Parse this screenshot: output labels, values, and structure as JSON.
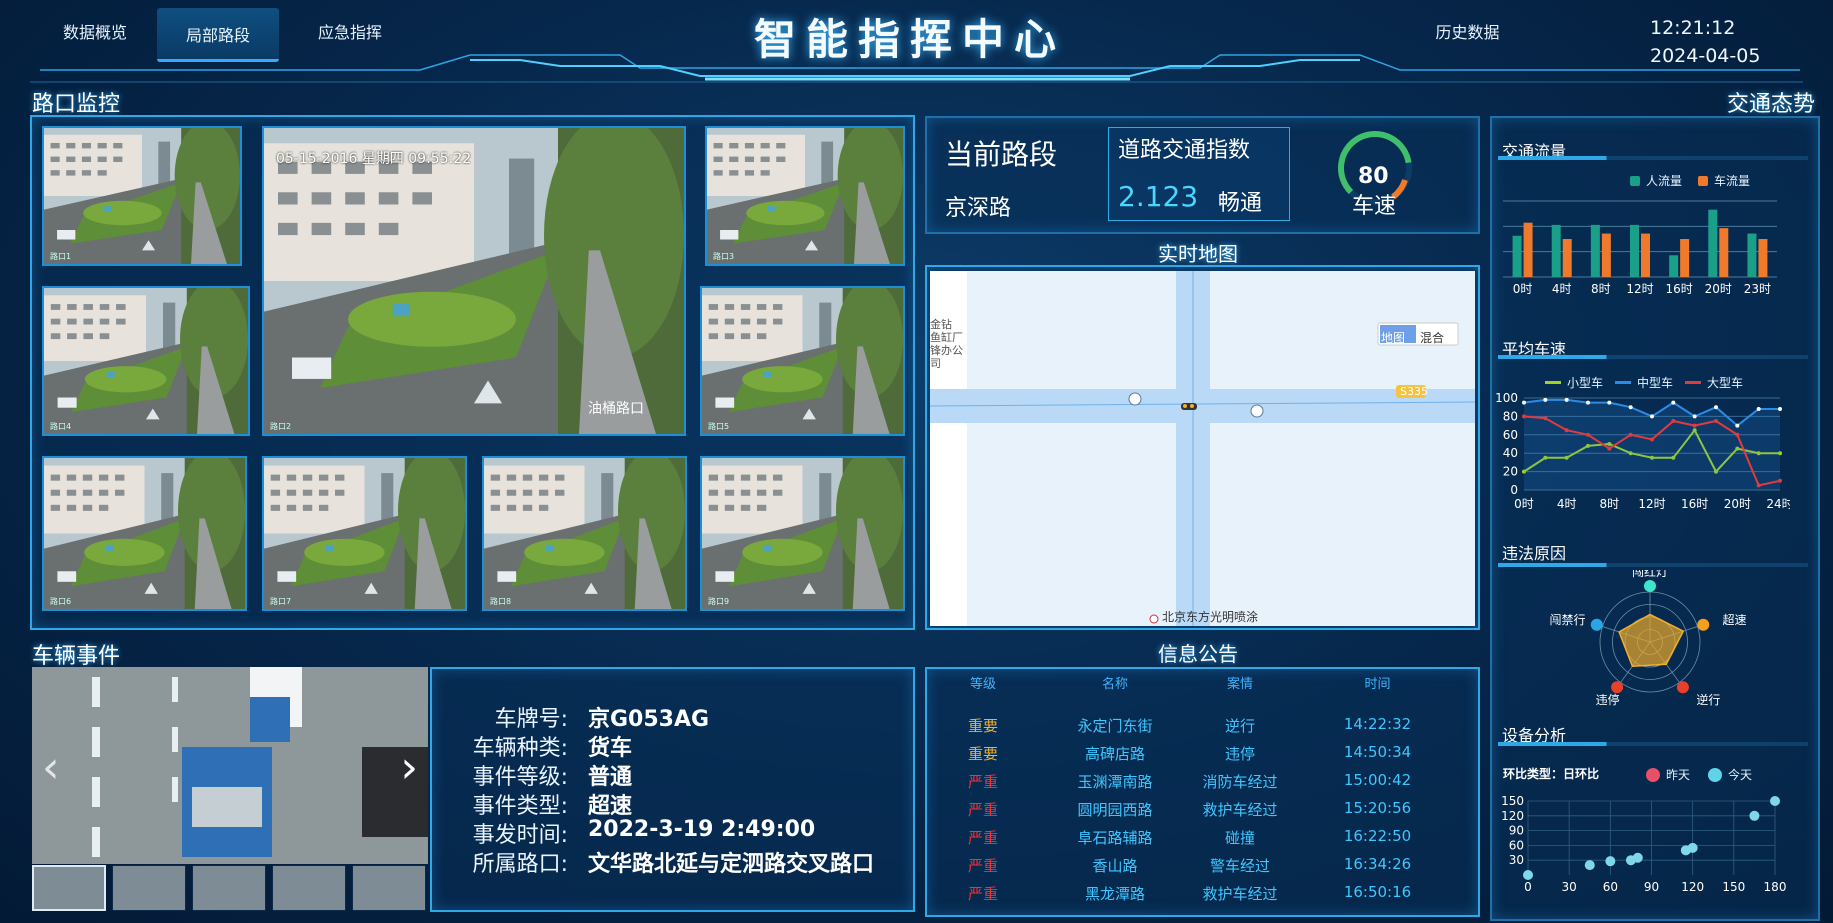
{
  "nav": {
    "tabs": [
      {
        "label": "数据概览"
      },
      {
        "label": "局部路段"
      },
      {
        "label": "应急指挥"
      }
    ],
    "history": "历史数据",
    "title": "智能指挥中心",
    "time": "12:21:12",
    "date": "2024-04-05"
  },
  "monitor": {
    "title": "路口监控",
    "cameras": [
      "路口1",
      "路口2",
      "路口3",
      "路口4",
      "路口5",
      "路口6",
      "路口7",
      "路口8",
      "路口9"
    ],
    "osd": "05-15-2016 星期四 09:55:22",
    "watermark": "油桶路口"
  },
  "road": {
    "current_label": "当前路段",
    "current_name": "京深路",
    "index_label": "道路交通指数",
    "index_value": "2.123",
    "index_status": "畅通",
    "speed_value": "80",
    "speed_label": "车速",
    "speed_fraction": 0.8
  },
  "map": {
    "title": "实时地图",
    "btn_map": "地图",
    "btn_hybrid": "混合",
    "road_label": "S335",
    "poi_left": "金钻\n鱼缸厂\n锋办公\n司",
    "poi_bottom": "北京东方光明喷涂"
  },
  "trend": {
    "title": "交通态势",
    "flow": {
      "title": "交通流量",
      "legend_people": "人流量",
      "legend_cars": "车流量"
    },
    "speed": {
      "title": "平均车速",
      "legend_small": "小型车",
      "legend_mid": "中型车",
      "legend_large": "大型车"
    },
    "violation": {
      "title": "违法原因",
      "labels": [
        "闯红灯",
        "超速",
        "逆行",
        "违停",
        "闯禁行"
      ]
    },
    "device": {
      "title": "设备分析",
      "ring_label": "环比类型：日环比",
      "legend_yesterday": "昨天",
      "legend_today": "今天"
    }
  },
  "colors": {
    "people": "#1aa089",
    "cars": "#f07a2c",
    "small": "#a4d31e",
    "mid": "#2a8ce8",
    "large": "#e23b3b",
    "accent": "#2ea8e6"
  },
  "chart_data": [
    {
      "type": "bar",
      "categories": [
        "0时",
        "4时",
        "8时",
        "12时",
        "16时",
        "20时",
        "23时"
      ],
      "series": [
        {
          "name": "人流量",
          "values": [
            38,
            48,
            48,
            48,
            20,
            62,
            40
          ]
        },
        {
          "name": "车流量",
          "values": [
            50,
            35,
            40,
            40,
            35,
            45,
            35
          ]
        }
      ],
      "ylim": [
        0,
        70
      ]
    },
    {
      "type": "line",
      "x": [
        0,
        2,
        4,
        6,
        8,
        10,
        12,
        14,
        16,
        18,
        20,
        22,
        24
      ],
      "x_ticks": [
        "0时",
        "4时",
        "8时",
        "12时",
        "16时",
        "20时",
        "24时"
      ],
      "series": [
        {
          "name": "小型车",
          "values": [
            20,
            35,
            35,
            48,
            50,
            40,
            35,
            35,
            65,
            20,
            45,
            40,
            40
          ]
        },
        {
          "name": "中型车",
          "values": [
            95,
            98,
            98,
            95,
            95,
            90,
            80,
            95,
            80,
            90,
            70,
            88,
            88
          ]
        },
        {
          "name": "大型车",
          "values": [
            80,
            78,
            65,
            60,
            45,
            60,
            55,
            75,
            70,
            75,
            60,
            5,
            10
          ]
        }
      ],
      "y_ticks": [
        0,
        20,
        40,
        60,
        80,
        100
      ],
      "ylim": [
        0,
        100
      ]
    },
    {
      "type": "radar",
      "axes": [
        "闯红灯",
        "超速",
        "逆行",
        "违停",
        "闯禁行"
      ],
      "values": [
        55,
        70,
        55,
        60,
        65
      ]
    },
    {
      "type": "scatter",
      "x_ticks": [
        0,
        30,
        60,
        90,
        120,
        150,
        180
      ],
      "y_ticks": [
        30,
        60,
        90,
        120,
        150
      ],
      "series": [
        {
          "name": "今天",
          "points": [
            [
              0,
              0
            ],
            [
              45,
              20
            ],
            [
              60,
              28
            ],
            [
              75,
              30
            ],
            [
              80,
              35
            ],
            [
              115,
              50
            ],
            [
              120,
              55
            ],
            [
              165,
              120
            ],
            [
              180,
              150
            ]
          ]
        }
      ],
      "xlim": [
        0,
        180
      ],
      "ylim": [
        0,
        150
      ]
    }
  ],
  "events": {
    "title": "车辆事件",
    "rows": [
      {
        "k": "车牌号:",
        "v": "京G053AG"
      },
      {
        "k": "车辆种类:",
        "v": "货车"
      },
      {
        "k": "事件等级:",
        "v": "普通"
      },
      {
        "k": "事件类型:",
        "v": "超速"
      },
      {
        "k": "事发时间:",
        "v": "2022-3-19 2:49:00"
      },
      {
        "k": "所属路口:",
        "v": "文华路北延与定泗路交叉路口"
      }
    ]
  },
  "notice": {
    "title": "信息公告",
    "headers": [
      "等级",
      "名称",
      "案情",
      "时间"
    ],
    "rows": [
      {
        "level": "重要",
        "name": "永定门东街",
        "case": "逆行",
        "time": "14:22:32"
      },
      {
        "level": "重要",
        "name": "高碑店路",
        "case": "违停",
        "time": "14:50:34"
      },
      {
        "level": "严重",
        "name": "玉渊潭南路",
        "case": "消防车经过",
        "time": "15:00:42"
      },
      {
        "level": "严重",
        "name": "圆明园西路",
        "case": "救护车经过",
        "time": "15:20:56"
      },
      {
        "level": "严重",
        "name": "阜石路辅路",
        "case": "碰撞",
        "time": "16:22:50"
      },
      {
        "level": "严重",
        "name": "香山路",
        "case": "警车经过",
        "time": "16:34:26"
      },
      {
        "level": "严重",
        "name": "黑龙潭路",
        "case": "救护车经过",
        "time": "16:50:16"
      }
    ]
  }
}
